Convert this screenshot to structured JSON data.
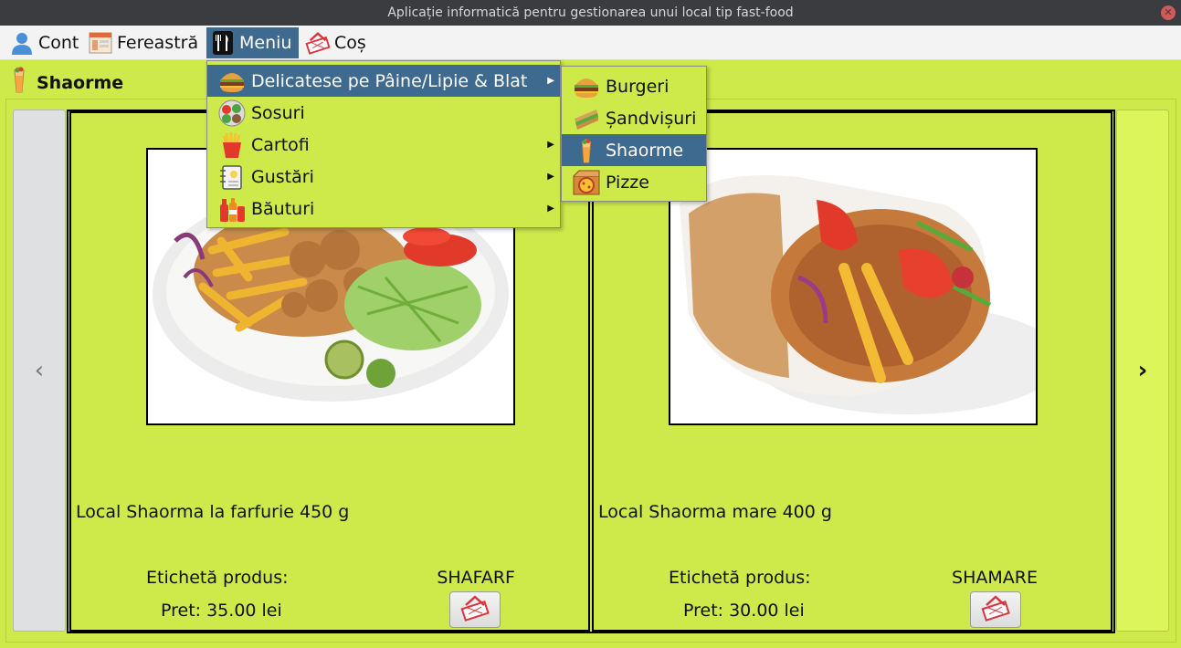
{
  "window": {
    "title": "Aplicație informatică pentru gestionarea unui local tip fast-food"
  },
  "menubar": {
    "items": [
      {
        "label": "Cont",
        "icon": "user-icon"
      },
      {
        "label": "Fereastră",
        "icon": "window-icon"
      },
      {
        "label": "Meniu",
        "icon": "cutlery-icon"
      },
      {
        "label": "Coș",
        "icon": "basket-icon"
      }
    ]
  },
  "header": {
    "title": "Shaorme",
    "icon": "shawarma-icon"
  },
  "menu_dropdown": {
    "items": [
      {
        "label": "Delicatese pe Pâine/Lipie & Blat",
        "icon": "burger-icon",
        "has_submenu": true
      },
      {
        "label": "Sosuri",
        "icon": "sauces-icon",
        "has_submenu": false
      },
      {
        "label": "Cartofi",
        "icon": "fries-icon",
        "has_submenu": true
      },
      {
        "label": "Gustări",
        "icon": "snacks-icon",
        "has_submenu": true
      },
      {
        "label": "Băuturi",
        "icon": "drinks-icon",
        "has_submenu": true
      }
    ]
  },
  "submenu": {
    "items": [
      {
        "label": "Burgeri",
        "icon": "burger-icon"
      },
      {
        "label": "Șandvișuri",
        "icon": "sandwich-icon"
      },
      {
        "label": "Shaorme",
        "icon": "shawarma-icon"
      },
      {
        "label": "Pizze",
        "icon": "pizza-icon"
      }
    ]
  },
  "products": [
    {
      "name": "Local Shaorma la farfurie 450 g",
      "tag_label": "Etichetă produs:",
      "tag": "SHAFARF",
      "price": "Pret: 35.00 lei"
    },
    {
      "name": "Local Shaorma mare 400 g",
      "tag_label": "Etichetă produs:",
      "tag": "SHAMARE",
      "price": "Pret: 30.00 lei"
    }
  ],
  "nav": {
    "prev": "‹",
    "next": "›"
  },
  "colors": {
    "background": "#cde94a",
    "highlight": "#3f6a8f",
    "titlebar": "#3a3c40"
  }
}
